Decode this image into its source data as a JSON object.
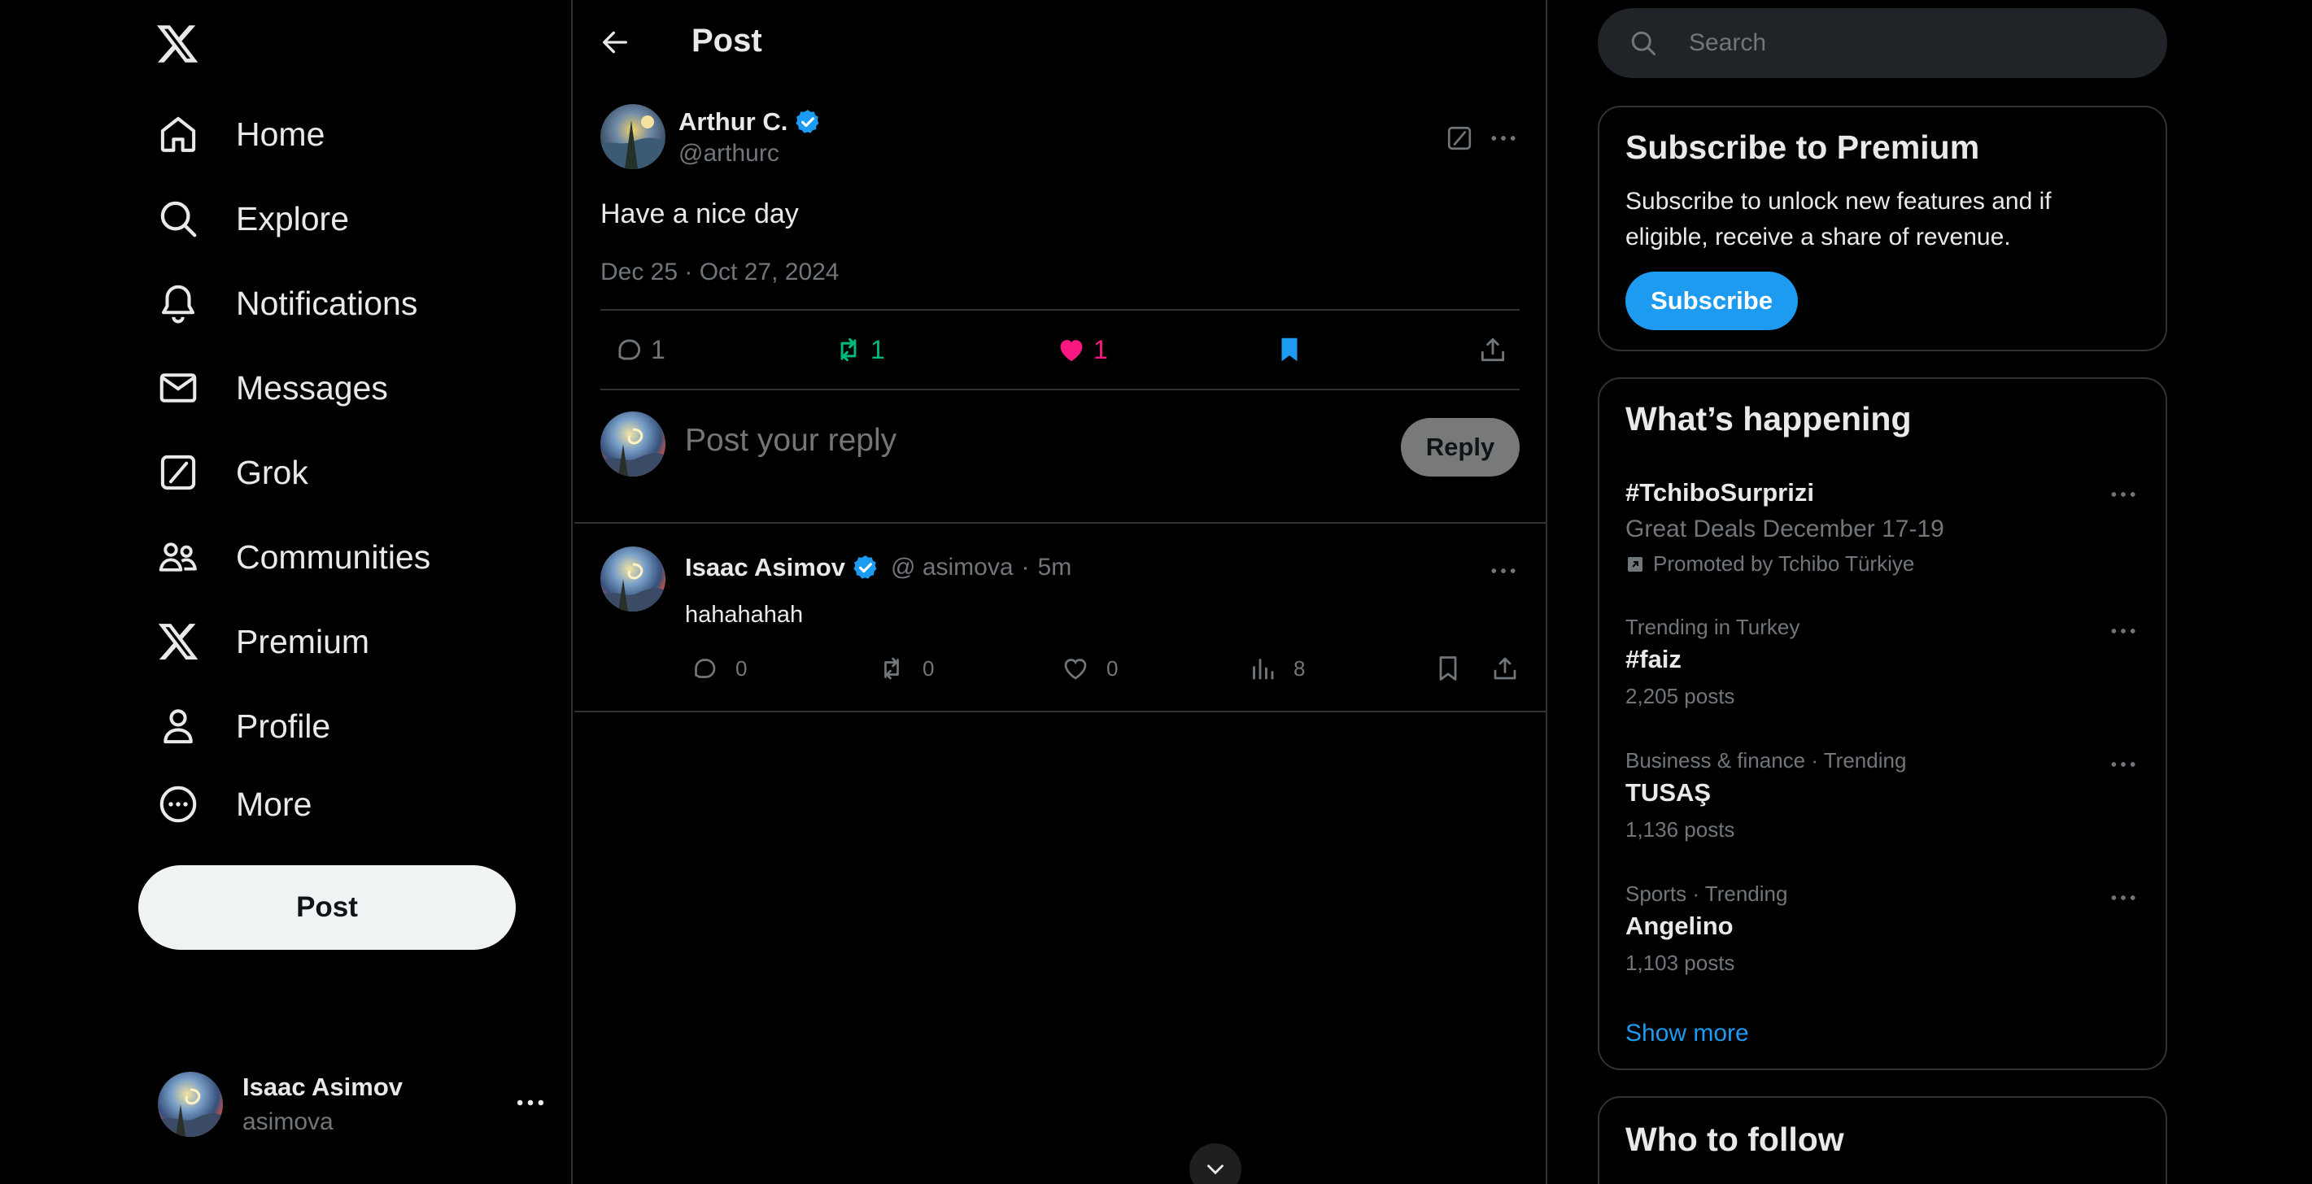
{
  "colors": {
    "background": "#000000",
    "text": "#e7e9ea",
    "muted": "#71767b",
    "accent": "#1d9bf0",
    "repost": "#00ba7c",
    "like": "#f91880",
    "border": "#2f3336"
  },
  "sidebar": {
    "logo": "x-logo-icon",
    "nav": [
      {
        "label": "Home",
        "icon": "home-icon"
      },
      {
        "label": "Explore",
        "icon": "search-icon"
      },
      {
        "label": "Notifications",
        "icon": "bell-icon"
      },
      {
        "label": "Messages",
        "icon": "mail-icon"
      },
      {
        "label": "Grok",
        "icon": "grok-icon"
      },
      {
        "label": "Communities",
        "icon": "communities-icon"
      },
      {
        "label": "Premium",
        "icon": "x-logo-icon"
      },
      {
        "label": "Profile",
        "icon": "person-icon"
      },
      {
        "label": "More",
        "icon": "more-circle-icon"
      }
    ],
    "post_button": "Post",
    "account": {
      "name": "Isaac Asimov",
      "handle": "asimova"
    }
  },
  "header": {
    "title": "Post"
  },
  "post": {
    "author": "Arthur C.",
    "handle": "@arthurc",
    "text": "Have a nice day",
    "date": "Dec 25 · Oct 27, 2024",
    "replies": "1",
    "reposts": "1",
    "likes": "1",
    "bookmarked": true
  },
  "reply_box": {
    "placeholder": "Post your reply",
    "button": "Reply"
  },
  "replies": [
    {
      "author": "Isaac Asimov",
      "handle": "@ asimova",
      "time": "5m",
      "text": "hahahahah",
      "replies": "0",
      "reposts": "0",
      "likes": "0",
      "views": "8"
    }
  ],
  "right": {
    "search_placeholder": "Search",
    "premium": {
      "title": "Subscribe to Premium",
      "description": "Subscribe to unlock new features and if eligible, receive a share of revenue.",
      "button": "Subscribe"
    },
    "happening": {
      "title": "What’s happening",
      "trends": [
        {
          "name": "#TchiboSurprizi",
          "subtitle": "Great Deals December 17-19",
          "promoted": "Promoted by Tchibo Türkiye"
        },
        {
          "context": "Trending in Turkey",
          "name": "#faiz",
          "count": "2,205 posts"
        },
        {
          "context": "Business & finance · Trending",
          "name": "TUSAŞ",
          "count": "1,136 posts"
        },
        {
          "context": "Sports · Trending",
          "name": "Angelino",
          "count": "1,103 posts"
        }
      ],
      "show_more": "Show more"
    },
    "who_to_follow": {
      "title": "Who to follow"
    }
  }
}
